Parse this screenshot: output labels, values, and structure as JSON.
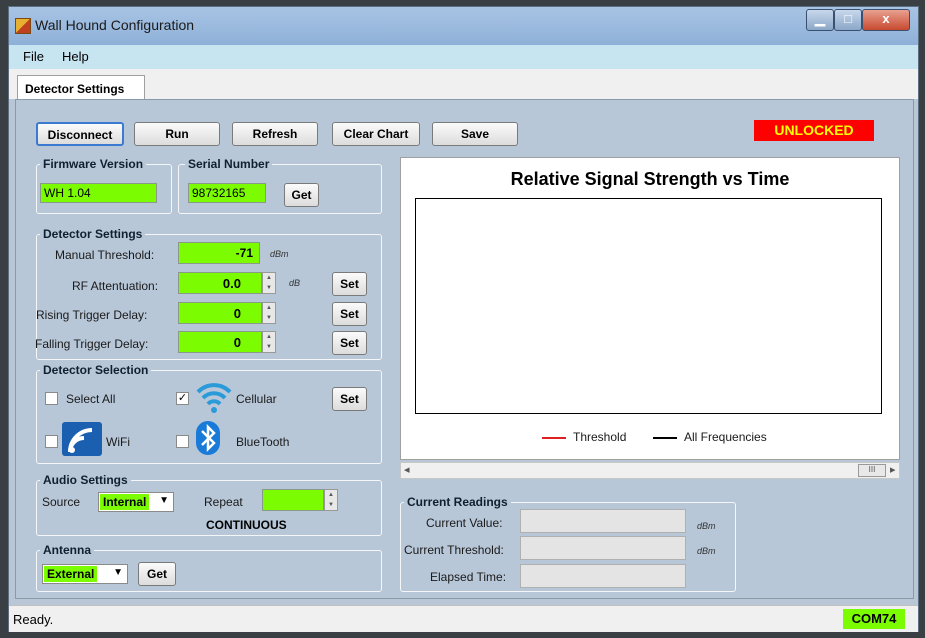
{
  "window": {
    "title": "Wall Hound Configuration",
    "min": "▁",
    "max": "□",
    "close": "x"
  },
  "menu": [
    "File",
    "Help"
  ],
  "tab": "Detector Settings",
  "toolbar": {
    "disconnect": "Disconnect",
    "run": "Run",
    "refresh": "Refresh",
    "clear_chart": "Clear Chart",
    "save": "Save",
    "lock_status": "UNLOCKED"
  },
  "firmware": {
    "title": "Firmware Version",
    "value": "WH 1.04"
  },
  "serial": {
    "title": "Serial Number",
    "value": "98732165",
    "get": "Get"
  },
  "detector_settings": {
    "title": "Detector Settings",
    "manual_threshold": {
      "label": "Manual Threshold:",
      "value": "-71",
      "unit": "dBm"
    },
    "rf_attenuation": {
      "label": "RF Attentuation:",
      "value": "0.0",
      "unit": "dB",
      "set": "Set"
    },
    "rising_delay": {
      "label": "Rising Trigger Delay:",
      "value": "0",
      "set": "Set"
    },
    "falling_delay": {
      "label": "Falling Trigger Delay:",
      "value": "0",
      "set": "Set"
    }
  },
  "detector_selection": {
    "title": "Detector Selection",
    "select_all": "Select All",
    "cellular": "Cellular",
    "wifi": "WiFi",
    "bluetooth": "BlueTooth",
    "set": "Set",
    "cellular_checked": "✓"
  },
  "chart": {
    "title": "Relative Signal Strength vs Time",
    "legend": [
      "Threshold",
      "All Frequencies"
    ],
    "colors": {
      "threshold": "#e02020",
      "all": "#000000"
    },
    "scroll_left": "◂",
    "scroll_right": "▸",
    "scroll_thumb": "III"
  },
  "chart_data": {
    "type": "line",
    "title": "Relative Signal Strength vs Time",
    "series": [
      {
        "name": "Threshold",
        "values": []
      },
      {
        "name": "All Frequencies",
        "values": []
      }
    ],
    "legend": "bottom"
  },
  "audio": {
    "title": "Audio Settings",
    "source_label": "Source",
    "source_value": "Internal",
    "repeat_label": "Repeat",
    "mode": "CONTINUOUS"
  },
  "antenna": {
    "title": "Antenna",
    "value": "External",
    "get": "Get"
  },
  "readings": {
    "title": "Current Readings",
    "current_value": {
      "label": "Current Value:",
      "unit": "dBm"
    },
    "current_threshold": {
      "label": "Current Threshold:",
      "unit": "dBm"
    },
    "elapsed": {
      "label": "Elapsed Time:"
    }
  },
  "status": {
    "text": "Ready.",
    "port": "COM74"
  }
}
